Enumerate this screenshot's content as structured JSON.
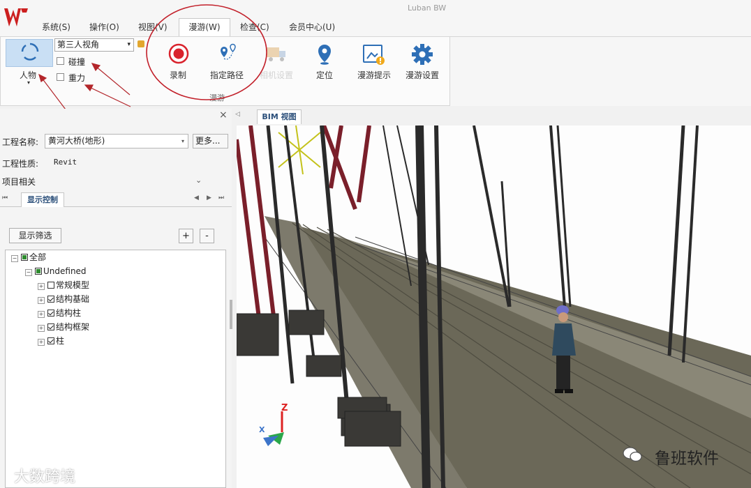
{
  "app": {
    "title": "Luban BW"
  },
  "menu": {
    "tabs": [
      {
        "label": "系统(S)"
      },
      {
        "label": "操作(O)"
      },
      {
        "label": "视图(V)"
      },
      {
        "label": "漫游(W)"
      },
      {
        "label": "检查(C)"
      },
      {
        "label": "会员中心(U)"
      }
    ],
    "active_tab": "漫游(W)"
  },
  "ribbon": {
    "person_label": "人物",
    "view_mode": "第三人视角",
    "collision_label": "碰撞",
    "gravity_label": "重力",
    "buttons": [
      {
        "label": "录制",
        "icon": "record-icon"
      },
      {
        "label": "指定路径",
        "icon": "route-pin-icon"
      },
      {
        "label": "相机设置",
        "icon": "camera-truck-icon",
        "disabled": true
      },
      {
        "label": "定位",
        "icon": "location-pin-icon"
      },
      {
        "label": "漫游提示",
        "icon": "roam-tip-icon"
      },
      {
        "label": "漫游设置",
        "icon": "gear-icon"
      }
    ],
    "group_label": "漫游"
  },
  "left_panel": {
    "project_name_label": "工程名称:",
    "project_name_value": "黄河大桥(地形)",
    "more_button": "更多...",
    "project_type_label": "工程性质:",
    "project_type_value": "Revit",
    "related_label": "项目相关",
    "tab_label": "显示控制",
    "filter_button": "显示筛选",
    "plus_button": "+",
    "minus_button": "-",
    "tree": [
      {
        "label": "全部",
        "level": 0,
        "state": "partial"
      },
      {
        "label": "Undefined",
        "level": 1,
        "state": "partial"
      },
      {
        "label": "常规模型",
        "level": 2,
        "state": "unchecked"
      },
      {
        "label": "结构基础",
        "level": 2,
        "state": "checked"
      },
      {
        "label": "结构柱",
        "level": 2,
        "state": "checked"
      },
      {
        "label": "结构框架",
        "level": 2,
        "state": "checked"
      },
      {
        "label": "柱",
        "level": 2,
        "state": "checked"
      }
    ]
  },
  "viewport": {
    "tab_label": "BIM 视图",
    "axis_z": "Z",
    "axis_x": "X"
  },
  "watermarks": {
    "left": "大数跨境",
    "right": "鲁班软件"
  }
}
